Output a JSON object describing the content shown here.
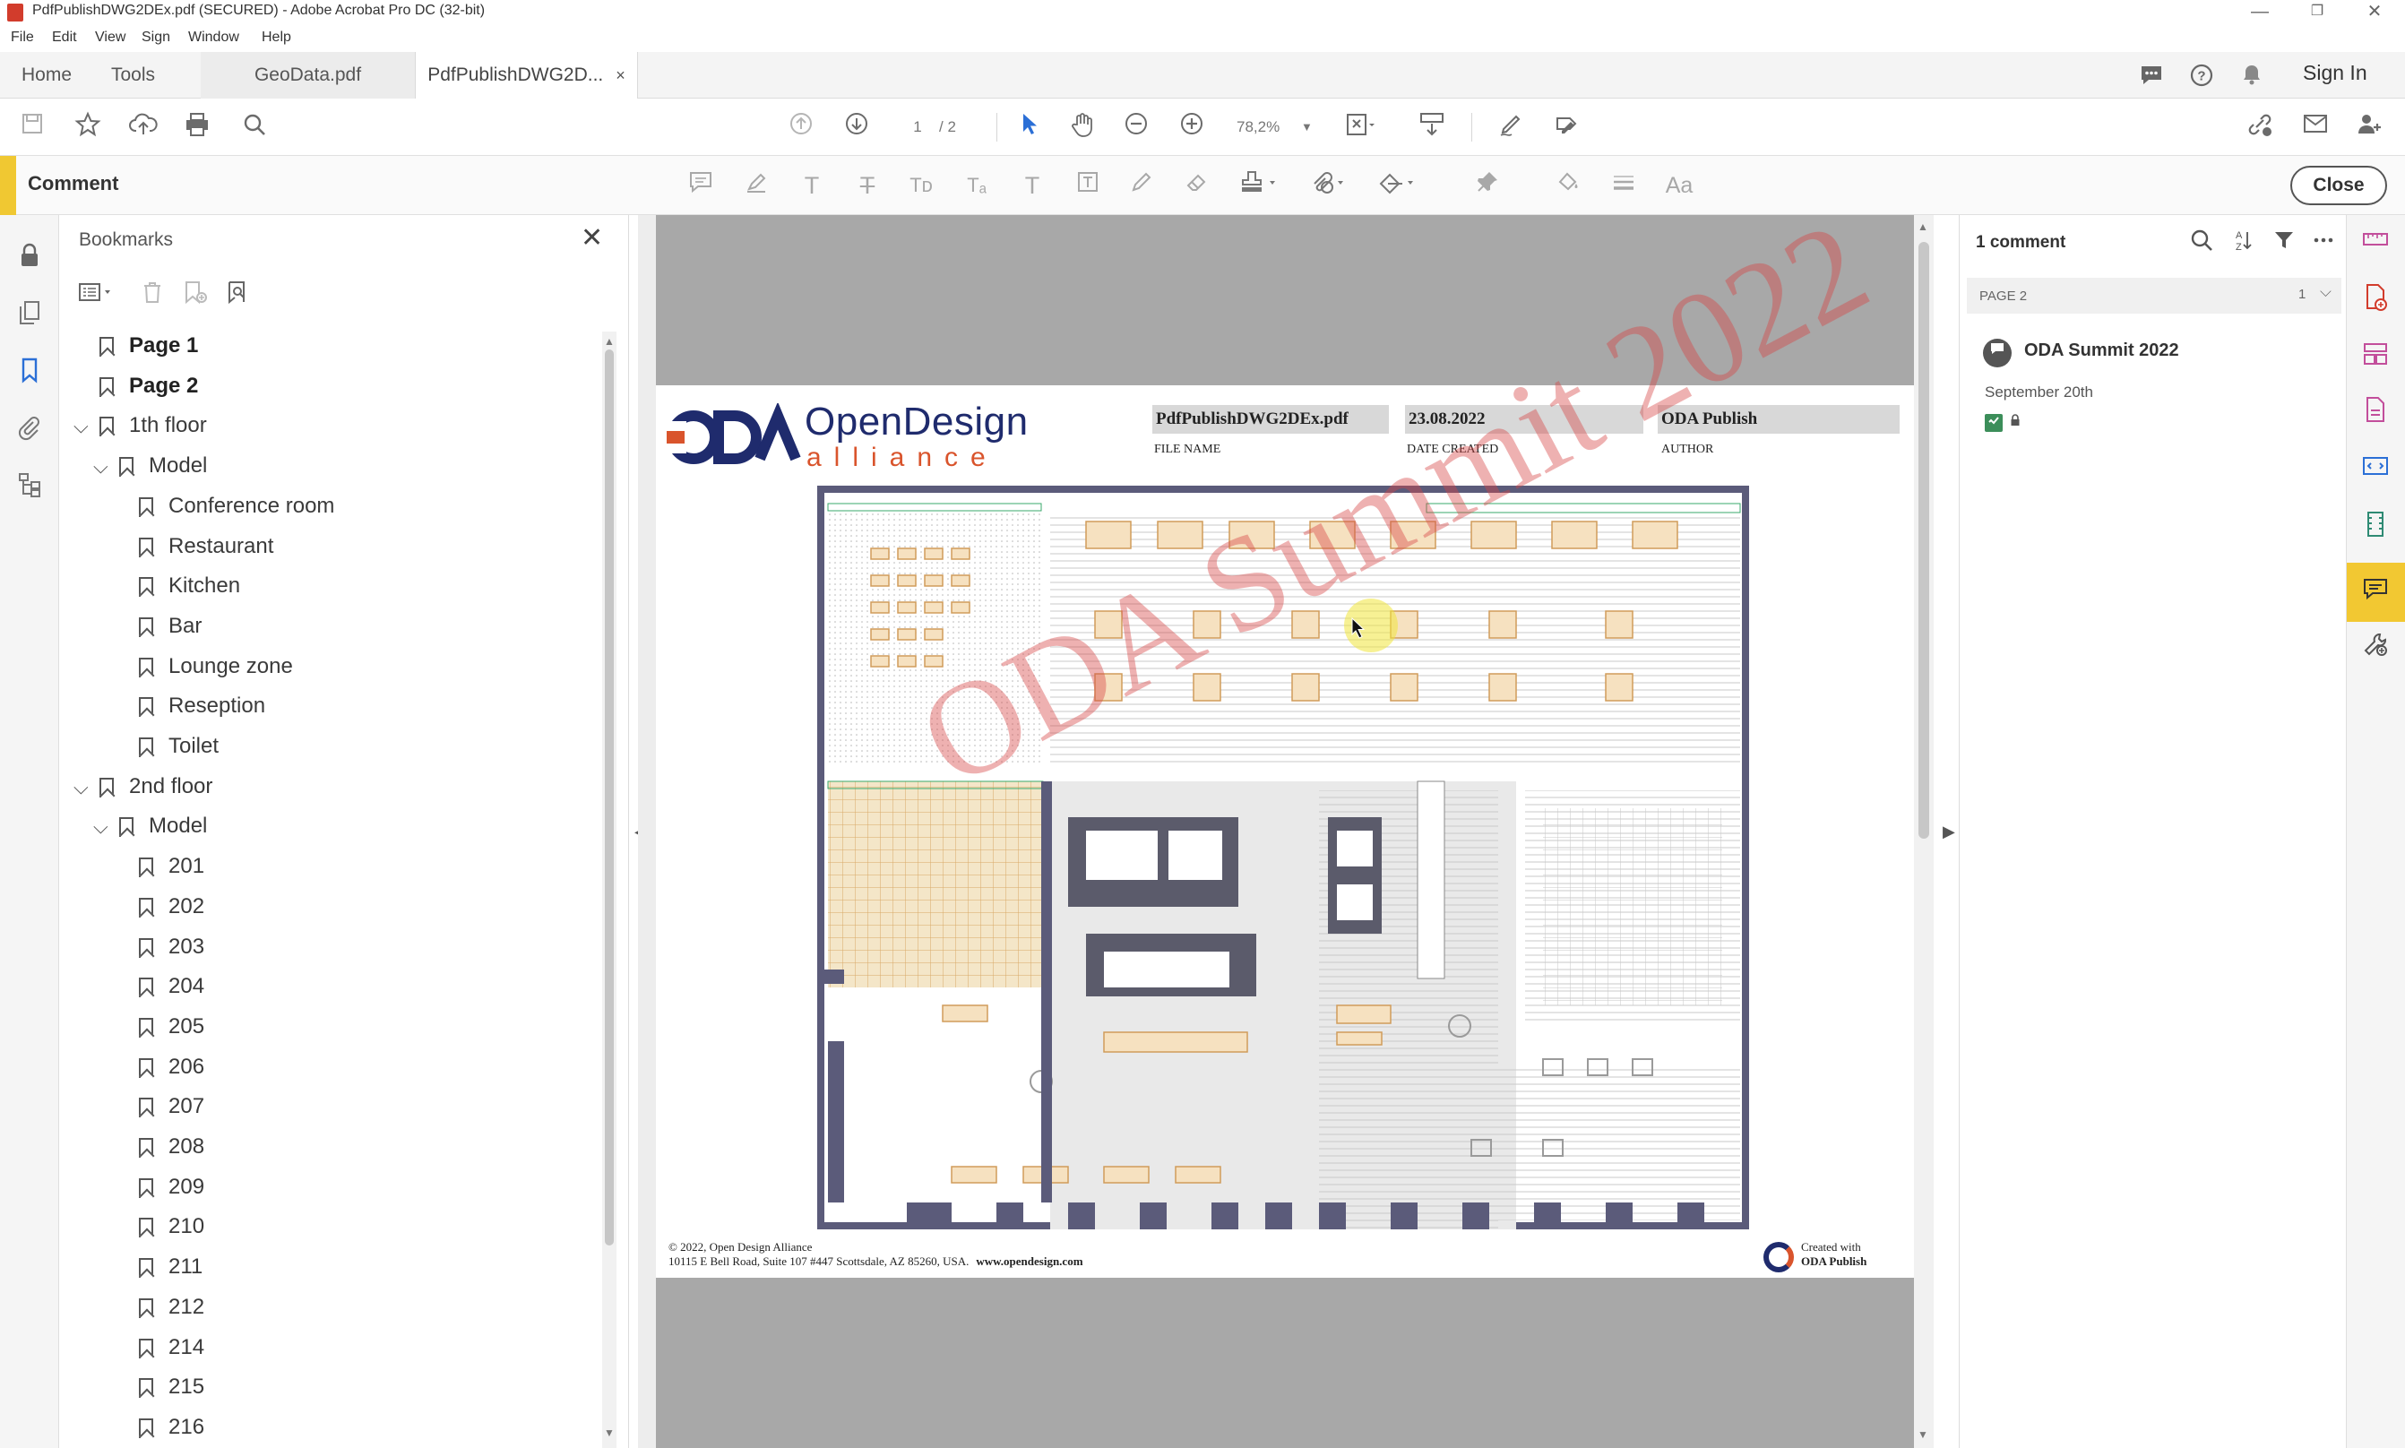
{
  "window": {
    "title": "PdfPublishDWG2DEx.pdf (SECURED) - Adobe Acrobat Pro DC (32-bit)",
    "minimize": "—",
    "restore": "❐",
    "close": "✕"
  },
  "menu": [
    "File",
    "Edit",
    "View",
    "Sign",
    "Window",
    "Help"
  ],
  "tabs": {
    "home": "Home",
    "tools": "Tools",
    "docs": [
      {
        "label": "GeoData.pdf"
      },
      {
        "label": "PdfPublishDWG2D...",
        "close": "×"
      }
    ],
    "sign_in": "Sign In"
  },
  "toolbar": {
    "page_current": "1",
    "page_total": "/ 2",
    "zoom": "78,2%"
  },
  "comment_bar": {
    "title": "Comment",
    "close": "Close",
    "text_tools": [
      "T",
      "T",
      "Tᴅ",
      "Tₐ",
      "T"
    ],
    "aa": "Aa"
  },
  "bookmarks": {
    "title": "Bookmarks",
    "close": "✕",
    "items": [
      {
        "label": "Page 1",
        "level": 0,
        "bold": true,
        "expand": false
      },
      {
        "label": "Page 2",
        "level": 0,
        "bold": true,
        "expand": false
      },
      {
        "label": "1th floor",
        "level": 0,
        "bold": false,
        "expand": true
      },
      {
        "label": "Model",
        "level": 1,
        "bold": false,
        "expand": true
      },
      {
        "label": "Conference room",
        "level": 2
      },
      {
        "label": "Restaurant",
        "level": 2
      },
      {
        "label": "Kitchen",
        "level": 2
      },
      {
        "label": "Bar",
        "level": 2
      },
      {
        "label": "Lounge zone",
        "level": 2
      },
      {
        "label": "Reseption",
        "level": 2
      },
      {
        "label": "Toilet",
        "level": 2
      },
      {
        "label": "2nd floor",
        "level": 0,
        "bold": false,
        "expand": true
      },
      {
        "label": "Model",
        "level": 1,
        "bold": false,
        "expand": true
      },
      {
        "label": "201",
        "level": 2
      },
      {
        "label": "202",
        "level": 2
      },
      {
        "label": "203",
        "level": 2
      },
      {
        "label": "204",
        "level": 2
      },
      {
        "label": "205",
        "level": 2
      },
      {
        "label": "206",
        "level": 2
      },
      {
        "label": "207",
        "level": 2
      },
      {
        "label": "208",
        "level": 2
      },
      {
        "label": "209",
        "level": 2
      },
      {
        "label": "210",
        "level": 2
      },
      {
        "label": "211",
        "level": 2
      },
      {
        "label": "212",
        "level": 2
      },
      {
        "label": "214",
        "level": 2
      },
      {
        "label": "215",
        "level": 2
      },
      {
        "label": "216",
        "level": 2
      }
    ]
  },
  "document": {
    "logo_name": "OpenDesign",
    "logo_sub": "alliance",
    "file_name": "PdfPublishDWG2DEx.pdf",
    "file_name_label": "FILE NAME",
    "date_created": "23.08.2022",
    "date_created_label": "DATE CREATED",
    "author": "ODA Publish",
    "author_label": "AUTHOR",
    "watermark": "ODA Summit 2022",
    "footer_copyright": "© 2022, Open Design Alliance",
    "footer_address": "10115 E Bell Road, Suite 107 #447 Scottsdale, AZ 85260, USA.",
    "footer_url": "www.opendesign.com",
    "created_with": "Created with",
    "created_with_product": "ODA Publish"
  },
  "comments": {
    "count": "1 comment",
    "page_label": "PAGE 2",
    "page_count": "1",
    "items": [
      {
        "author": "ODA Summit 2022",
        "date": "September 20th"
      }
    ]
  },
  "colors": {
    "accent_yellow": "#f0c832",
    "brand_blue": "#1f2b6d",
    "brand_orange": "#d9542c",
    "select_blue": "#2b6fd6",
    "watermark_red": "#d74646"
  }
}
